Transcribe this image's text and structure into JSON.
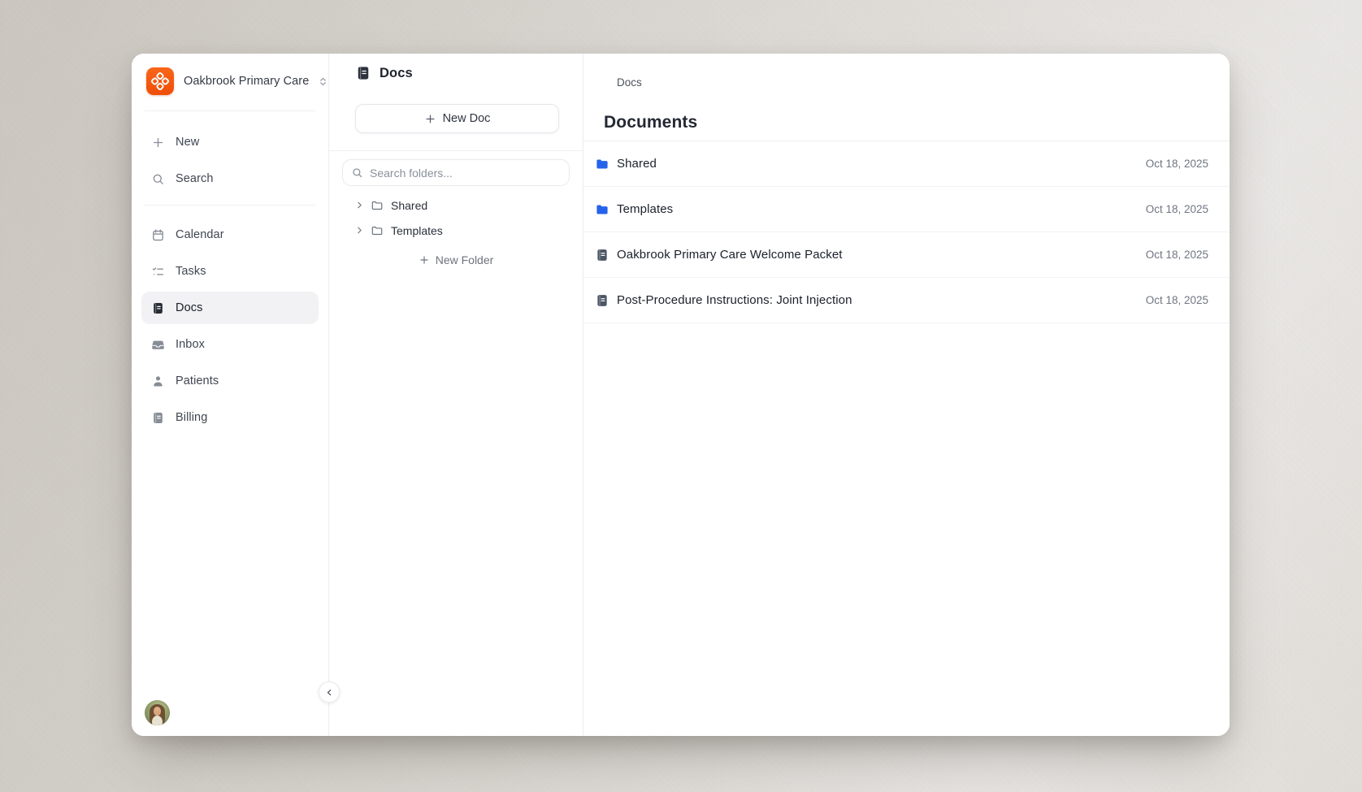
{
  "workspace": {
    "name": "Oakbrook Primary Care"
  },
  "sidebar": {
    "primary": [
      {
        "label": "New"
      },
      {
        "label": "Search"
      }
    ],
    "nav": [
      {
        "label": "Calendar"
      },
      {
        "label": "Tasks"
      },
      {
        "label": "Docs",
        "active": true
      },
      {
        "label": "Inbox"
      },
      {
        "label": "Patients"
      },
      {
        "label": "Billing"
      }
    ]
  },
  "folders_panel": {
    "title": "Docs",
    "new_doc_button": "New Doc",
    "search_placeholder": "Search folders...",
    "tree": [
      {
        "label": "Shared"
      },
      {
        "label": "Templates"
      }
    ],
    "new_folder_button": "New Folder"
  },
  "content": {
    "breadcrumb": "Docs",
    "title": "Documents",
    "rows": [
      {
        "name": "Shared",
        "type": "folder",
        "date": "Oct 18, 2025"
      },
      {
        "name": "Templates",
        "type": "folder",
        "date": "Oct 18, 2025"
      },
      {
        "name": "Oakbrook Primary Care Welcome Packet",
        "type": "doc",
        "date": "Oct 18, 2025"
      },
      {
        "name": "Post-Procedure Instructions: Joint Injection",
        "type": "doc",
        "date": "Oct 18, 2025"
      }
    ]
  },
  "colors": {
    "brand_orange": "#f2570f",
    "folder_blue": "#2563eb",
    "doc_icon_slate": "#4b5563"
  }
}
